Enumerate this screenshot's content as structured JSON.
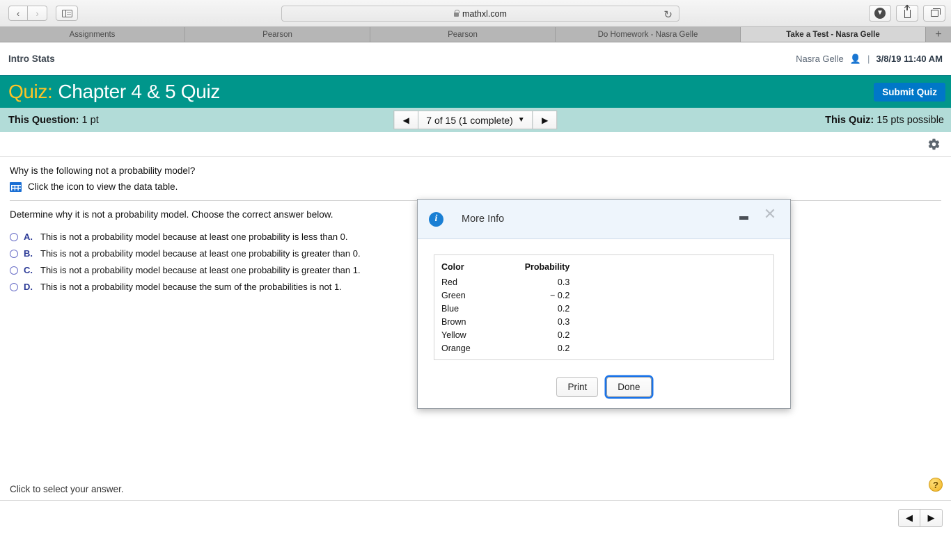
{
  "browser": {
    "url": "mathxl.com",
    "back_icon": "chevron-left-icon",
    "forward_icon": "chevron-right-icon",
    "sidebar_icon": "sidebar-toggle-icon",
    "lock_icon": "lock-icon",
    "reload_icon": "reload-icon",
    "download_icon": "download-icon",
    "share_icon": "share-icon",
    "tabs_icon": "show-tabs-icon",
    "new_tab_label": "+",
    "tabs": [
      {
        "label": "Assignments",
        "active": false
      },
      {
        "label": "Pearson",
        "active": false
      },
      {
        "label": "Pearson",
        "active": false
      },
      {
        "label": "Do Homework - Nasra Gelle",
        "active": false
      },
      {
        "label": "Take a Test - Nasra Gelle",
        "active": true
      }
    ]
  },
  "header": {
    "course_title": "Intro Stats",
    "user_name": "Nasra Gelle",
    "user_icon": "person-icon",
    "separator": "|",
    "datetime": "3/8/19 11:40 AM"
  },
  "quiz_bar": {
    "prefix": "Quiz:",
    "title": "Chapter 4 & 5 Quiz",
    "submit_label": "Submit Quiz",
    "bg_color": "#00968b",
    "prefix_color": "#ffc425",
    "submit_color": "#0077c8"
  },
  "subbar": {
    "this_question_label": "This Question:",
    "this_question_value": "1 pt",
    "prev_icon": "triangle-left-icon",
    "next_icon": "triangle-right-icon",
    "question_selector": "7 of 15 (1 complete)",
    "caret_icon": "caret-down-icon",
    "this_quiz_label": "This Quiz:",
    "this_quiz_value": "15 pts possible",
    "bg_color": "#b2dcd8"
  },
  "toolbar": {
    "gear_icon": "gear-icon"
  },
  "question": {
    "stem": "Why is the following not a probability model?",
    "table_icon": "data-table-icon",
    "table_link_text": "Click the icon to view the data table.",
    "prompt": "Determine why it is not a probability model. Choose the correct answer below.",
    "choices": [
      {
        "letter": "A.",
        "text": "This is not a probability model because at least one probability is less than 0."
      },
      {
        "letter": "B.",
        "text": "This is not a probability model because at least one probability is greater than 0."
      },
      {
        "letter": "C.",
        "text": "This is not a probability model because at least one probability is greater than 1."
      },
      {
        "letter": "D.",
        "text": "This is not a probability model because the sum of the probabilities is not 1."
      }
    ]
  },
  "footer": {
    "status_text": "Click to select your answer.",
    "help_icon": "question-mark-icon",
    "help_label": "?",
    "prev_icon": "triangle-left-icon",
    "next_icon": "triangle-right-icon"
  },
  "modal": {
    "info_icon": "info-icon",
    "info_glyph": "i",
    "title": "More Info",
    "minimize_icon": "minimize-icon",
    "close_icon": "close-icon",
    "table": {
      "headers": [
        "Color",
        "Probability"
      ],
      "rows": [
        {
          "color": "Red",
          "probability": "0.3"
        },
        {
          "color": "Green",
          "probability": "− 0.2"
        },
        {
          "color": "Blue",
          "probability": "0.2"
        },
        {
          "color": "Brown",
          "probability": "0.3"
        },
        {
          "color": "Yellow",
          "probability": "0.2"
        },
        {
          "color": "Orange",
          "probability": "0.2"
        }
      ]
    },
    "print_label": "Print",
    "done_label": "Done"
  }
}
